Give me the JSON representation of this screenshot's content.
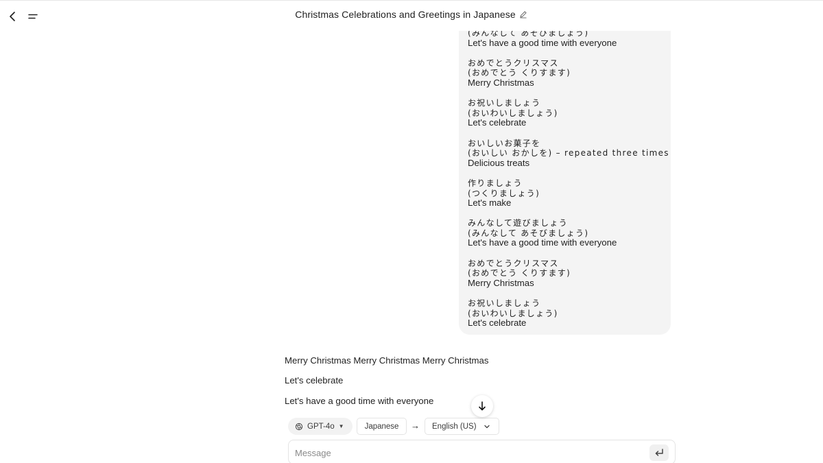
{
  "header": {
    "title": "Christmas Celebrations and Greetings in Japanese"
  },
  "user_message": {
    "groups": [
      {
        "lines": [
          {
            "text": "(みんなして あそびましょう)",
            "jp": true
          },
          {
            "text": "Let's have a good time with everyone",
            "jp": false
          }
        ]
      },
      {
        "lines": [
          {
            "text": "おめでとうクリスマス",
            "jp": true
          },
          {
            "text": "(おめでとう くりすます)",
            "jp": true
          },
          {
            "text": "Merry Christmas",
            "jp": false
          }
        ]
      },
      {
        "lines": [
          {
            "text": "お祝いしましょう",
            "jp": true
          },
          {
            "text": "(おいわいしましょう)",
            "jp": true
          },
          {
            "text": "Let's celebrate",
            "jp": false
          }
        ]
      },
      {
        "lines": [
          {
            "text": "おいしいお菓子を",
            "jp": true
          },
          {
            "text": "(おいしい おかしを) – repeated three times",
            "jp": true
          },
          {
            "text": "Delicious treats",
            "jp": false
          }
        ]
      },
      {
        "lines": [
          {
            "text": "作りましょう",
            "jp": true
          },
          {
            "text": "(つくりましょう)",
            "jp": true
          },
          {
            "text": "Let's make",
            "jp": false
          }
        ]
      },
      {
        "lines": [
          {
            "text": "みんなして遊びましょう",
            "jp": true
          },
          {
            "text": "(みんなして あそびましょう)",
            "jp": true
          },
          {
            "text": "Let's have a good time with everyone",
            "jp": false
          }
        ]
      },
      {
        "lines": [
          {
            "text": "おめでとうクリスマス",
            "jp": true
          },
          {
            "text": "(おめでとう くりすます)",
            "jp": true
          },
          {
            "text": "Merry Christmas",
            "jp": false
          }
        ]
      },
      {
        "lines": [
          {
            "text": "お祝いしましょう",
            "jp": true
          },
          {
            "text": "(おいわいしましょう)",
            "jp": true
          },
          {
            "text": "Let's celebrate",
            "jp": false
          }
        ]
      }
    ]
  },
  "assistant_message": {
    "lines": [
      "Merry Christmas Merry Christmas Merry Christmas",
      "Let's celebrate",
      "Let's have a good time with everyone"
    ]
  },
  "controls": {
    "model": "GPT-4o",
    "source_language": "Japanese",
    "arrow": "→",
    "target_language": "English (US)"
  },
  "composer": {
    "placeholder": "Message"
  },
  "icons": {
    "back": "chevron-left-icon",
    "menu": "menu-icon",
    "edit": "pencil-icon",
    "scroll": "arrow-down-icon",
    "model": "openai-logo-icon",
    "dropdown": "chevron-down-icon",
    "send": "enter-icon"
  }
}
